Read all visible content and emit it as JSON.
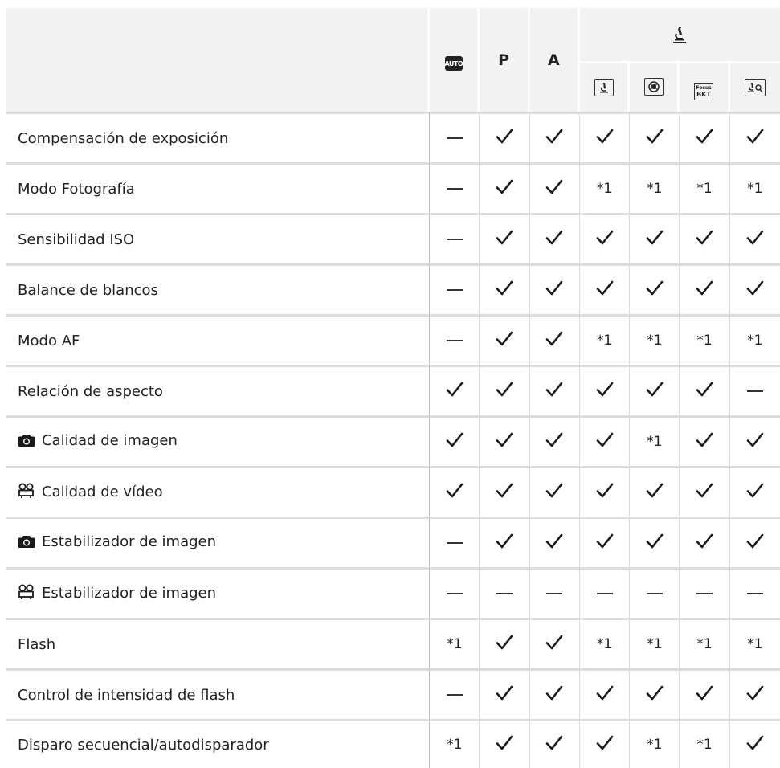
{
  "header": {
    "auto_mode_icon": "iauto-camera-icon",
    "col_p": "P",
    "col_a": "A",
    "group_icon": "microscope-mode-icon",
    "sub_icons": [
      "microscope-icon",
      "focus-stacking-icon",
      "focus-bkt-icon",
      "microscope-zoom-icon"
    ],
    "focus_bkt_line1": "Focus",
    "focus_bkt_line2": "BKT"
  },
  "rows": [
    {
      "label": "Compensación de exposición",
      "icon": "",
      "cells": [
        "—",
        "check",
        "check",
        "check",
        "check",
        "check",
        "check"
      ]
    },
    {
      "label": "Modo Fotografía",
      "icon": "",
      "cells": [
        "—",
        "check",
        "check",
        "*1",
        "*1",
        "*1",
        "*1"
      ]
    },
    {
      "label": "Sensibilidad ISO",
      "icon": "",
      "cells": [
        "—",
        "check",
        "check",
        "check",
        "check",
        "check",
        "check"
      ]
    },
    {
      "label": "Balance de blancos",
      "icon": "",
      "cells": [
        "—",
        "check",
        "check",
        "check",
        "check",
        "check",
        "check"
      ]
    },
    {
      "label": "Modo AF",
      "icon": "",
      "cells": [
        "—",
        "check",
        "check",
        "*1",
        "*1",
        "*1",
        "*1"
      ]
    },
    {
      "label": "Relación de aspecto",
      "icon": "",
      "cells": [
        "check",
        "check",
        "check",
        "check",
        "check",
        "check",
        "—"
      ]
    },
    {
      "label": "Calidad de imagen",
      "icon": "camera-icon",
      "cells": [
        "check",
        "check",
        "check",
        "check",
        "*1",
        "check",
        "check"
      ]
    },
    {
      "label": "Calidad de vídeo",
      "icon": "movie-icon",
      "cells": [
        "check",
        "check",
        "check",
        "check",
        "check",
        "check",
        "check"
      ]
    },
    {
      "label": "Estabilizador de imagen",
      "icon": "camera-icon",
      "cells": [
        "—",
        "check",
        "check",
        "check",
        "check",
        "check",
        "check"
      ]
    },
    {
      "label": "Estabilizador de imagen",
      "icon": "movie-icon",
      "cells": [
        "—",
        "—",
        "—",
        "—",
        "—",
        "—",
        "—"
      ]
    },
    {
      "label": "Flash",
      "icon": "",
      "cells": [
        "*1",
        "check",
        "check",
        "*1",
        "*1",
        "*1",
        "*1"
      ]
    },
    {
      "label": "Control de intensidad de flash",
      "icon": "",
      "cells": [
        "—",
        "check",
        "check",
        "check",
        "check",
        "check",
        "check"
      ]
    },
    {
      "label": "Disparo secuencial/autodisparador",
      "icon": "",
      "cells": [
        "*1",
        "check",
        "check",
        "check",
        "*1",
        "*1",
        "check"
      ]
    }
  ]
}
